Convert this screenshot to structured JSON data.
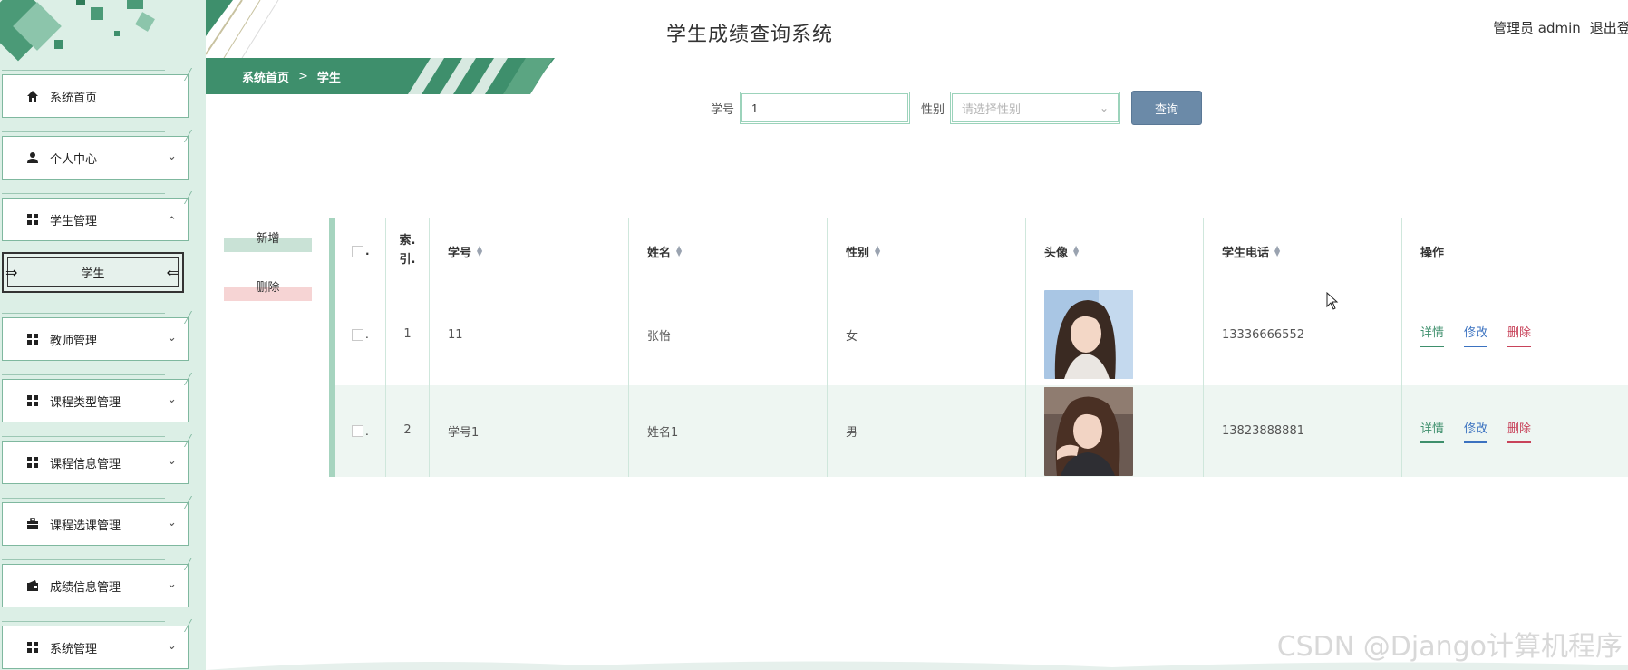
{
  "header": {
    "title": "学生成绩查询系统",
    "user_label": "管理员 admin",
    "logout_label": "退出登"
  },
  "breadcrumb": {
    "home": "系统首页",
    "separator": ">",
    "current": "学生"
  },
  "sidebar": {
    "items": [
      {
        "label": "系统首页",
        "icon": "home-icon"
      },
      {
        "label": "个人中心",
        "icon": "user-icon"
      },
      {
        "label": "学生管理",
        "icon": "grid-icon"
      },
      {
        "label": "教师管理",
        "icon": "grid-icon"
      },
      {
        "label": "课程类型管理",
        "icon": "grid-icon"
      },
      {
        "label": "课程信息管理",
        "icon": "grid-icon"
      },
      {
        "label": "课程选课管理",
        "icon": "briefcase-icon"
      },
      {
        "label": "成绩信息管理",
        "icon": "wallet-icon"
      },
      {
        "label": "系统管理",
        "icon": "grid-icon"
      }
    ],
    "active_sub_item": "学生"
  },
  "search": {
    "sid_label": "学号",
    "sid_value": "1",
    "sex_label": "性别",
    "sex_placeholder": "请选择性别",
    "query_label": "查询"
  },
  "actions": {
    "add_label": "新增",
    "delete_label": "删除"
  },
  "table": {
    "headers": {
      "checkbox": ".",
      "index_top": "索.",
      "index_bottom": "引.",
      "sid": "学号",
      "name": "姓名",
      "sex": "性别",
      "photo": "头像",
      "phone": "学生电话",
      "ops": "操作"
    },
    "rows": [
      {
        "check": ".",
        "index": "1",
        "sid": "11",
        "name": "张怡",
        "sex": "女",
        "phone": "13336666552"
      },
      {
        "check": ".",
        "index": "2",
        "sid": "学号1",
        "name": "姓名1",
        "sex": "男",
        "phone": "13823888881"
      }
    ],
    "ops": {
      "detail": "详情",
      "edit": "修改",
      "delete": "删除"
    }
  },
  "watermark": "CSDN @Django计算机程序",
  "colors": {
    "accent": "#3e8f6c",
    "sidebar_bg": "#dcefe6",
    "query_button": "#6b8aa8",
    "delete": "#c8435a",
    "edit": "#3b72c0"
  }
}
